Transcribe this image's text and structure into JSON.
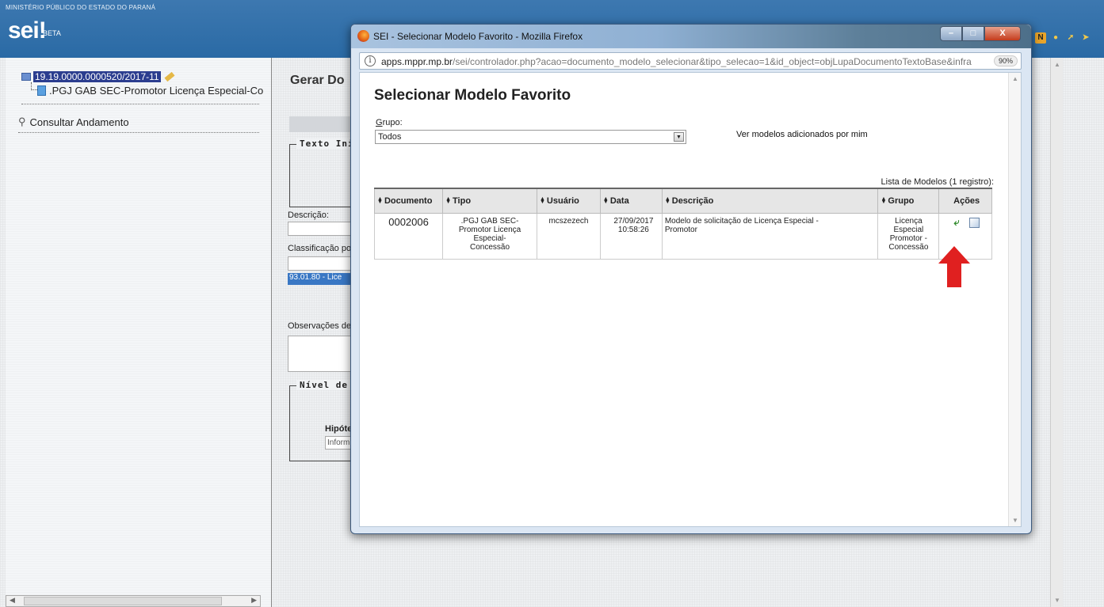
{
  "header": {
    "org": "MINISTÉRIO PÚBLICO DO ESTADO DO PARANÁ",
    "logo": "sei!",
    "beta": "BETA",
    "icons": [
      "notification-icon",
      "user-icon",
      "wrench-icon",
      "exit-icon"
    ]
  },
  "tree": {
    "process": "19.19.0000.0000520/2017-11",
    "document": ".PGJ GAB SEC-Promotor Licença Especial-Co",
    "consultar": "Consultar Andamento"
  },
  "bg": {
    "title": "Gerar Do",
    "texto_legend": "Texto Ini",
    "descricao": "Descrição:",
    "classificacao": "Classificação po",
    "class_value": "93.01.80 - Lice",
    "observacoes": "Observações de",
    "nivel_legend": "Nível de",
    "hipotese": "Hipóte",
    "hipotese_value": "Inform"
  },
  "popup": {
    "window_title": "SEI - Selecionar Modelo Favorito - Mozilla Firefox",
    "url_host": "apps.mppr.mp.br",
    "url_path": "/sei/controlador.php?acao=documento_modelo_selecionar&tipo_selecao=1&id_object=objLupaDocumentoTextoBase&infra",
    "zoom": "90%",
    "heading": "Selecionar Modelo Favorito",
    "grupo_label_u": "G",
    "grupo_label_rest": "rupo:",
    "grupo_value": "Todos",
    "ver_modelos": "Ver modelos adicionados por mim",
    "caption": "Lista de Modelos (1 registro):",
    "columns": [
      "Documento",
      "Tipo",
      "Usuário",
      "Data",
      "Descrição",
      "Grupo",
      "Ações"
    ],
    "row": {
      "documento": "0002006",
      "tipo": ".PGJ GAB SEC-Promotor Licença Especial- Concessão",
      "usuario": "mcszezech",
      "data": "27/09/2017 10:58:26",
      "descricao": "Modelo de solicitação de Licença Especial - Promotor",
      "grupo": "Licença Especial Promotor - Concessão"
    }
  },
  "colors": {
    "header": "#2a6aa5",
    "arrow": "#e02020",
    "selection": "#2b3d8f"
  }
}
